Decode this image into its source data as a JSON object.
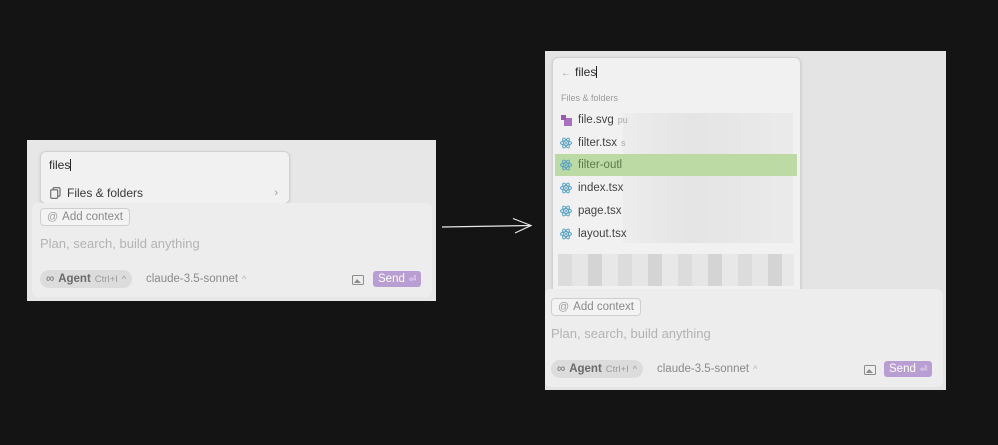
{
  "colors": {
    "background": "#141414",
    "panel": "#e7e7e7",
    "send": "#b99ed3",
    "selected": "#bcdba4",
    "svg_icon": "#9b59b6",
    "react_icon": "#5aa3c6"
  },
  "before": {
    "query": "files",
    "menu_item": {
      "icon": "copy-icon",
      "label": "Files & folders"
    },
    "add_context": "Add context",
    "placeholder": "Plan, search, build anything",
    "agent": {
      "label": "Agent",
      "shortcut": "Ctrl+I"
    },
    "model": "claude-3.5-sonnet",
    "send": "Send"
  },
  "after": {
    "back_arrow": "←",
    "query": "files",
    "section_label": "Files & folders",
    "files": [
      {
        "name": "file.svg",
        "hint": "pu",
        "icon": "svg-file-icon"
      },
      {
        "name": "filter.tsx",
        "hint": "s",
        "icon": "react-icon"
      },
      {
        "name": "filter-outl",
        "hint": "",
        "icon": "react-icon",
        "selected": true
      },
      {
        "name": "index.tsx",
        "hint": "",
        "icon": "react-icon"
      },
      {
        "name": "page.tsx",
        "hint": "",
        "icon": "react-icon"
      },
      {
        "name": "layout.tsx",
        "hint": "",
        "icon": "react-icon"
      }
    ],
    "add_context": "Add context",
    "placeholder": "Plan, search, build anything",
    "agent": {
      "label": "Agent",
      "shortcut": "Ctrl+I"
    },
    "model": "claude-3.5-sonnet",
    "send": "Send"
  }
}
